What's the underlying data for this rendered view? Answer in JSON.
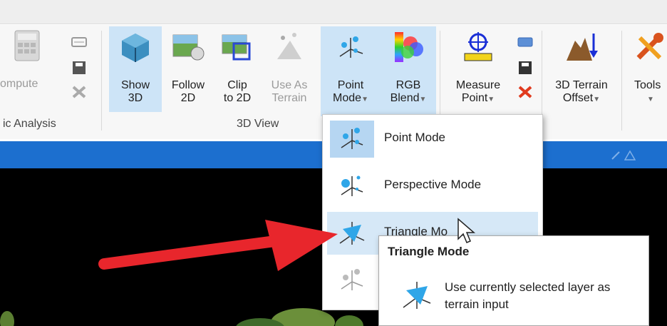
{
  "ribbon": {
    "compute_label": "ompute",
    "analysis_group_label": "ic Analysis",
    "show3d_label": [
      "Show",
      "3D"
    ],
    "follow2d_label": [
      "Follow",
      "2D"
    ],
    "clip2d_label": [
      "Clip",
      "to 2D"
    ],
    "useasterrain_label": [
      "Use As",
      "Terrain"
    ],
    "pointmode_label": [
      "Point",
      "Mode"
    ],
    "rgbblend_label": [
      "RGB",
      "Blend"
    ],
    "view3d_group_label": "3D View",
    "measure_label": [
      "Measure",
      "Point"
    ],
    "terrainoffset_label": [
      "3D Terrain",
      "Offset"
    ],
    "tools_label": "Tools"
  },
  "menu": {
    "items": [
      {
        "label": "Point Mode",
        "icon": "point-mode-icon"
      },
      {
        "label": "Perspective Mode",
        "icon": "perspective-mode-icon"
      },
      {
        "label": "Triangle Mo",
        "icon": "triangle-mode-icon"
      },
      {
        "label": "",
        "icon": "other-mode-icon"
      }
    ]
  },
  "tooltip": {
    "title": "Triangle Mode",
    "description": "Use currently selected layer as terrain input"
  },
  "colors": {
    "accent": "#1c6fcf",
    "selected": "#cde4f7",
    "arrow": "#e8262c",
    "icon_blue": "#2fa6e8"
  }
}
